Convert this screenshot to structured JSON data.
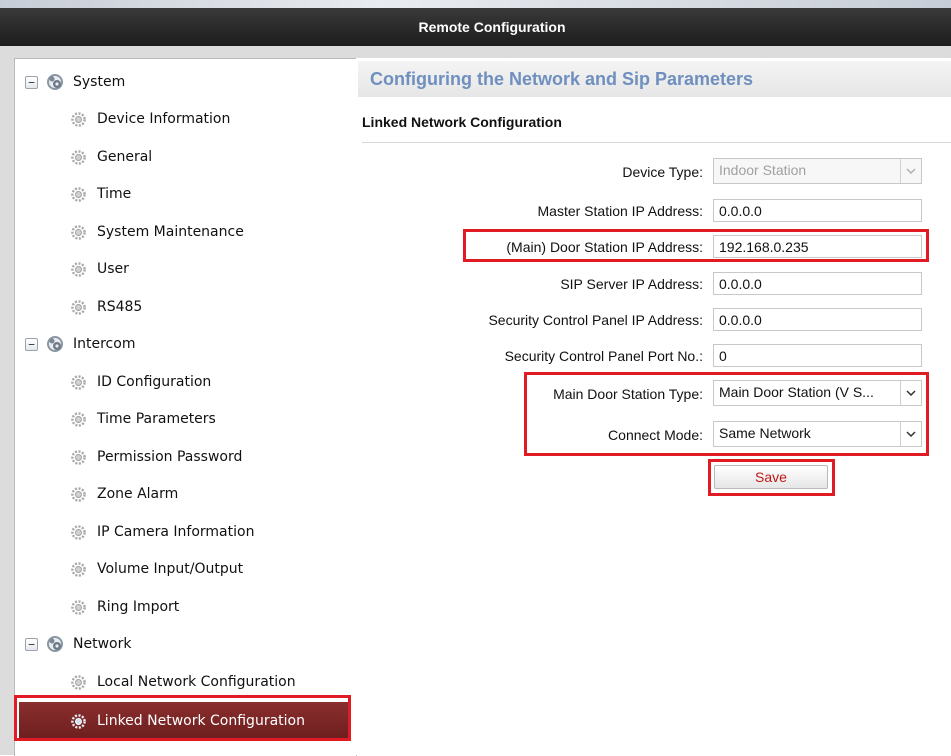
{
  "window": {
    "title": "Remote Configuration"
  },
  "sidebar": {
    "groups": [
      {
        "label": "System",
        "expander": "−",
        "icon": "settings-group-icon"
      },
      {
        "label": "Intercom",
        "expander": "−",
        "icon": "settings-group-icon"
      },
      {
        "label": "Network",
        "expander": "−",
        "icon": "settings-group-icon"
      }
    ],
    "items": [
      {
        "label": "Device Information",
        "icon": "gear-icon"
      },
      {
        "label": "General",
        "icon": "gear-icon"
      },
      {
        "label": "Time",
        "icon": "gear-icon"
      },
      {
        "label": "System Maintenance",
        "icon": "gear-icon"
      },
      {
        "label": "User",
        "icon": "gear-icon"
      },
      {
        "label": "RS485",
        "icon": "gear-icon"
      },
      {
        "label": "ID Configuration",
        "icon": "gear-icon"
      },
      {
        "label": "Time Parameters",
        "icon": "gear-icon"
      },
      {
        "label": "Permission Password",
        "icon": "gear-icon"
      },
      {
        "label": "Zone Alarm",
        "icon": "gear-icon"
      },
      {
        "label": "IP Camera Information",
        "icon": "gear-icon"
      },
      {
        "label": "Volume Input/Output",
        "icon": "gear-icon"
      },
      {
        "label": "Ring Import",
        "icon": "gear-icon"
      },
      {
        "label": "Local Network Configuration",
        "icon": "gear-icon"
      },
      {
        "label": "Linked Network Configuration",
        "icon": "gear-icon",
        "selected": true
      }
    ]
  },
  "main": {
    "header": "Configuring the Network and Sip Parameters",
    "subheader": "Linked Network Configuration",
    "fields": {
      "device_type": {
        "label": "Device Type:",
        "value": "Indoor Station"
      },
      "master_ip": {
        "label": "Master Station IP Address:",
        "value": "0.0.0.0"
      },
      "door_station_ip": {
        "label": "(Main) Door Station IP Address:",
        "value": "192.168.0.235"
      },
      "sip_server_ip": {
        "label": "SIP Server IP Address:",
        "value": "0.0.0.0"
      },
      "security_panel_ip": {
        "label": "Security Control Panel IP Address:",
        "value": "0.0.0.0"
      },
      "security_panel_port": {
        "label": "Security Control Panel Port No.:",
        "value": "0"
      },
      "main_door_type": {
        "label": "Main Door Station Type:",
        "value": "Main Door Station (V S..."
      },
      "connect_mode": {
        "label": "Connect Mode:",
        "value": "Same Network"
      }
    },
    "save_label": "Save"
  },
  "colors": {
    "highlight": "#e01b24",
    "selected_bg": "#7a2626",
    "header_text": "#6f8fbf",
    "save_text": "#c01818"
  }
}
